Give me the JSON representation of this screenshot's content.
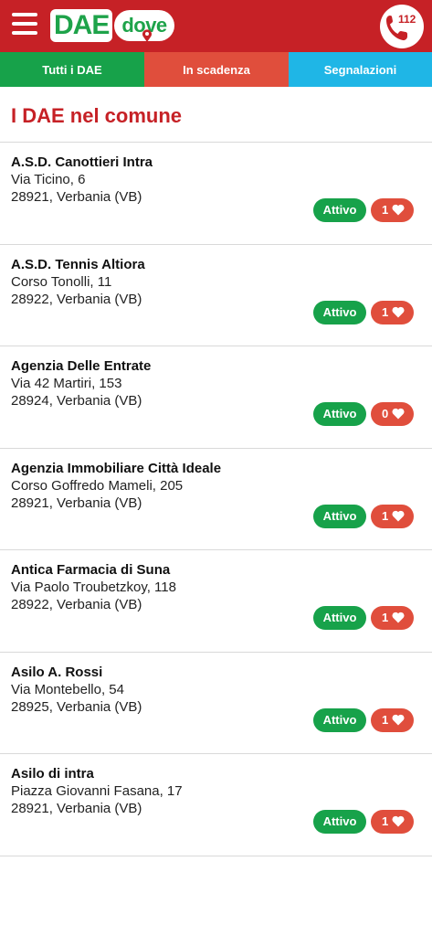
{
  "header": {
    "logo_dae": "DAE",
    "logo_dove": "dove",
    "emergency_number": "112",
    "icons": {
      "menu": "hamburger-menu-icon",
      "phone": "phone-icon",
      "pin": "map-pin-icon"
    }
  },
  "tabs": [
    {
      "label": "Tutti i DAE",
      "color": "#17a24a"
    },
    {
      "label": "In scadenza",
      "color": "#e04e3c"
    },
    {
      "label": "Segnalazioni",
      "color": "#1fb6e6"
    }
  ],
  "page_title": "I DAE nel comune",
  "colors": {
    "header": "#c62126",
    "status_active": "#17a24a",
    "likes": "#e04e3c"
  },
  "items": [
    {
      "name": "A.S.D. Canottieri Intra",
      "street": "Via Ticino, 6",
      "city": "28921, Verbania (VB)",
      "status": "Attivo",
      "likes": "1"
    },
    {
      "name": "A.S.D. Tennis Altiora",
      "street": "Corso Tonolli, 11",
      "city": "28922, Verbania (VB)",
      "status": "Attivo",
      "likes": "1"
    },
    {
      "name": "Agenzia Delle Entrate",
      "street": "Via 42 Martiri, 153",
      "city": "28924, Verbania (VB)",
      "status": "Attivo",
      "likes": "0"
    },
    {
      "name": "Agenzia Immobiliare Città Ideale",
      "street": "Corso Goffredo Mameli, 205",
      "city": "28921, Verbania (VB)",
      "status": "Attivo",
      "likes": "1"
    },
    {
      "name": "Antica Farmacia di Suna",
      "street": "Via Paolo Troubetzkoy, 118",
      "city": "28922, Verbania (VB)",
      "status": "Attivo",
      "likes": "1"
    },
    {
      "name": "Asilo A. Rossi",
      "street": "Via Montebello, 54",
      "city": "28925, Verbania (VB)",
      "status": "Attivo",
      "likes": "1"
    },
    {
      "name": "Asilo di intra",
      "street": "Piazza Giovanni Fasana, 17",
      "city": "28921, Verbania (VB)",
      "status": "Attivo",
      "likes": "1"
    }
  ]
}
